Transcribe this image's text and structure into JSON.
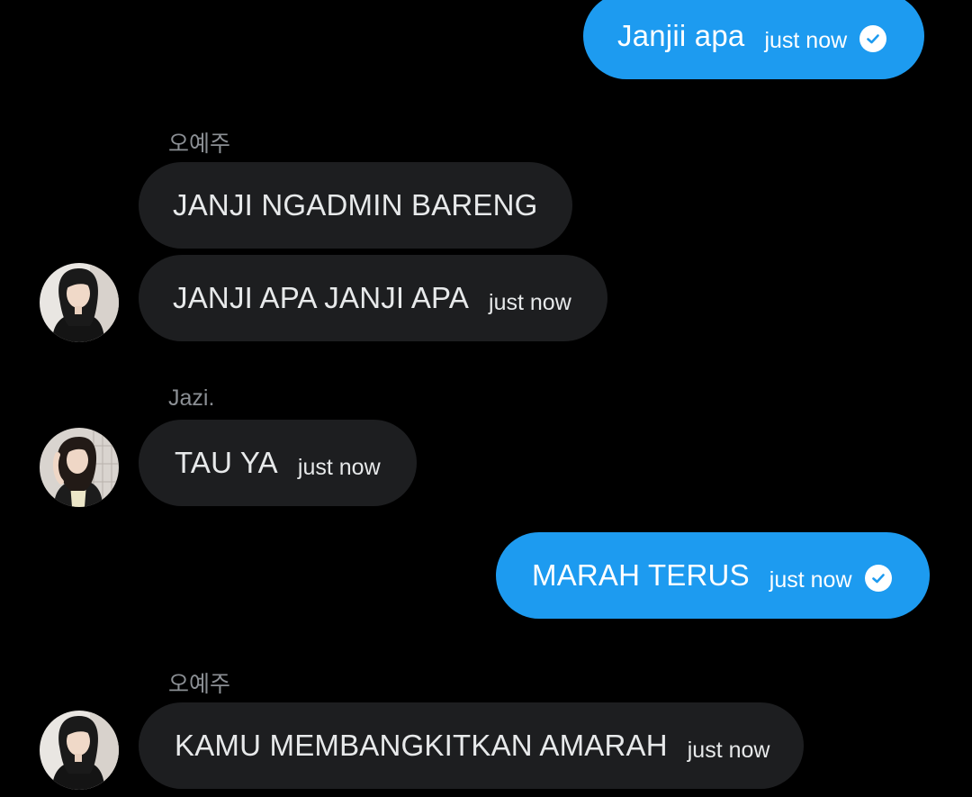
{
  "colors": {
    "background": "#000000",
    "incoming_bubble": "#1d1e20",
    "outgoing_bubble": "#1d9bf0",
    "sender_name": "#8b8f94"
  },
  "messages": [
    {
      "direction": "outgoing",
      "text": "Janjii apa",
      "time": "just now",
      "status_icon": "check-circle-icon"
    },
    {
      "direction": "incoming",
      "sender": "오예주",
      "text": "JANJI NGADMIN BARENG"
    },
    {
      "direction": "incoming",
      "text": "JANJI APA JANJI APA",
      "time": "just now",
      "avatar": "avatar-photo"
    },
    {
      "direction": "incoming",
      "sender": "Jazi.",
      "text": "TAU YA",
      "time": "just now",
      "avatar": "avatar-photo"
    },
    {
      "direction": "outgoing",
      "text": "MARAH TERUS",
      "time": "just now",
      "status_icon": "check-circle-icon"
    },
    {
      "direction": "incoming",
      "sender": "오예주",
      "text": "KAMU MEMBANGKITKAN AMARAH",
      "time": "just now",
      "avatar": "avatar-photo"
    }
  ]
}
